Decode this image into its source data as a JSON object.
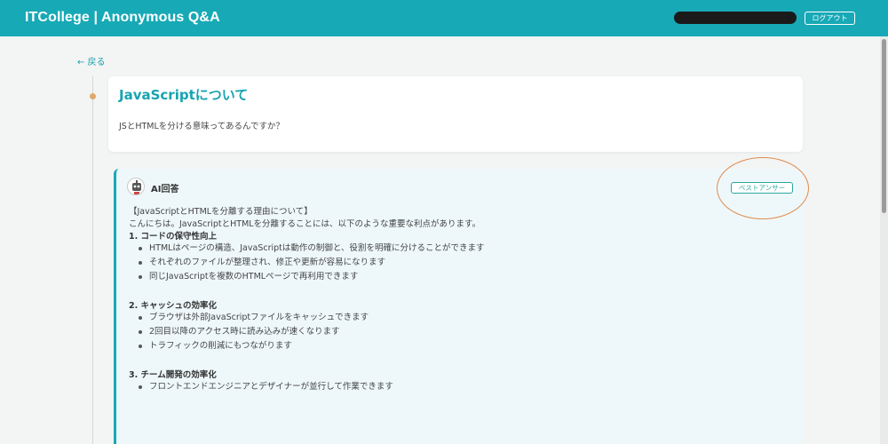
{
  "header": {
    "brand": "ITCollege | Anonymous Q&A",
    "logout_label": "ログアウト"
  },
  "nav": {
    "back_label": "← 戻る"
  },
  "question": {
    "title": "JavaScriptについて",
    "body": "JSとHTMLを分ける意味ってあるんですか？"
  },
  "answer": {
    "author_label": "AI回答",
    "badge": "ベストアンサー",
    "heading": "【JavaScriptとHTMLを分離する理由について】",
    "intro": "こんにちは。JavaScriptとHTMLを分離することには、以下のような重要な利点があります。",
    "sections": [
      {
        "title": "1. コードの保守性向上",
        "items": [
          "HTMLはページの構造、JavaScriptは動作の制御と、役割を明確に分けることができます",
          "それぞれのファイルが整理され、修正や更新が容易になります",
          "同じJavaScriptを複数のHTMLページで再利用できます"
        ]
      },
      {
        "title": "2. キャッシュの効率化",
        "items": [
          "ブラウザは外部JavaScriptファイルをキャッシュできます",
          "2回目以降のアクセス時に読み込みが速くなります",
          "トラフィックの削減にもつながります"
        ]
      },
      {
        "title": "3. チーム開発の効率化",
        "items": [
          "フロントエンドエンジニアとデザイナーが並行して作業できます"
        ]
      }
    ]
  },
  "colors": {
    "brand": "#17a9b6",
    "answer_bg": "#eef8fb",
    "highlight_circle": "#e08a4e",
    "timeline_dot": "#e0a86b"
  }
}
